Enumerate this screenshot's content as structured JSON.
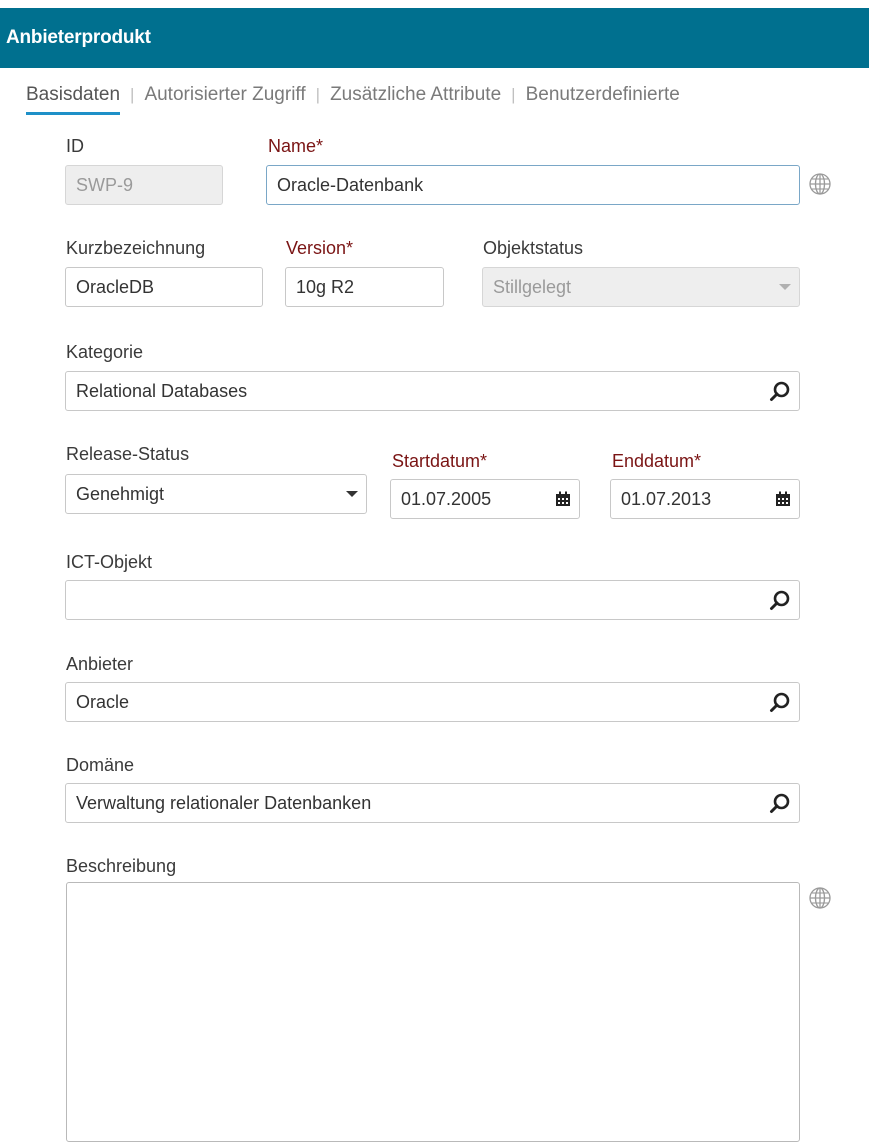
{
  "header": {
    "title": "Anbieterprodukt"
  },
  "tabs": [
    {
      "label": "Basisdaten"
    },
    {
      "label": "Autorisierter Zugriff"
    },
    {
      "label": "Zusätzliche Attribute"
    },
    {
      "label": "Benutzerdefinierte"
    }
  ],
  "form": {
    "id": {
      "label": "ID",
      "value": "SWP-9"
    },
    "name": {
      "label": "Name*",
      "value": "Oracle-Datenbank"
    },
    "short_name": {
      "label": "Kurzbezeichnung",
      "value": "OracleDB"
    },
    "version": {
      "label": "Version*",
      "value": "10g R2"
    },
    "object_status": {
      "label": "Objektstatus",
      "value": "Stillgelegt"
    },
    "category": {
      "label": "Kategorie",
      "value": "Relational Databases"
    },
    "release_status": {
      "label": "Release-Status",
      "value": "Genehmigt"
    },
    "start_date": {
      "label": "Startdatum*",
      "value": "01.07.2005"
    },
    "end_date": {
      "label": "Enddatum*",
      "value": "01.07.2013"
    },
    "ict_object": {
      "label": "ICT-Objekt",
      "value": ""
    },
    "vendor": {
      "label": "Anbieter",
      "value": "Oracle"
    },
    "domain": {
      "label": "Domäne",
      "value": "Verwaltung relationaler Datenbanken"
    },
    "description": {
      "label": "Beschreibung",
      "value": ""
    }
  },
  "icons": {
    "search": "search-icon",
    "calendar": "calendar-icon",
    "dropdown": "chevron-down-icon",
    "globe": "globe-icon"
  },
  "colors": {
    "header_bg": "#00708f",
    "tab_underline": "#1e90c8",
    "required_label": "#7a1414"
  }
}
